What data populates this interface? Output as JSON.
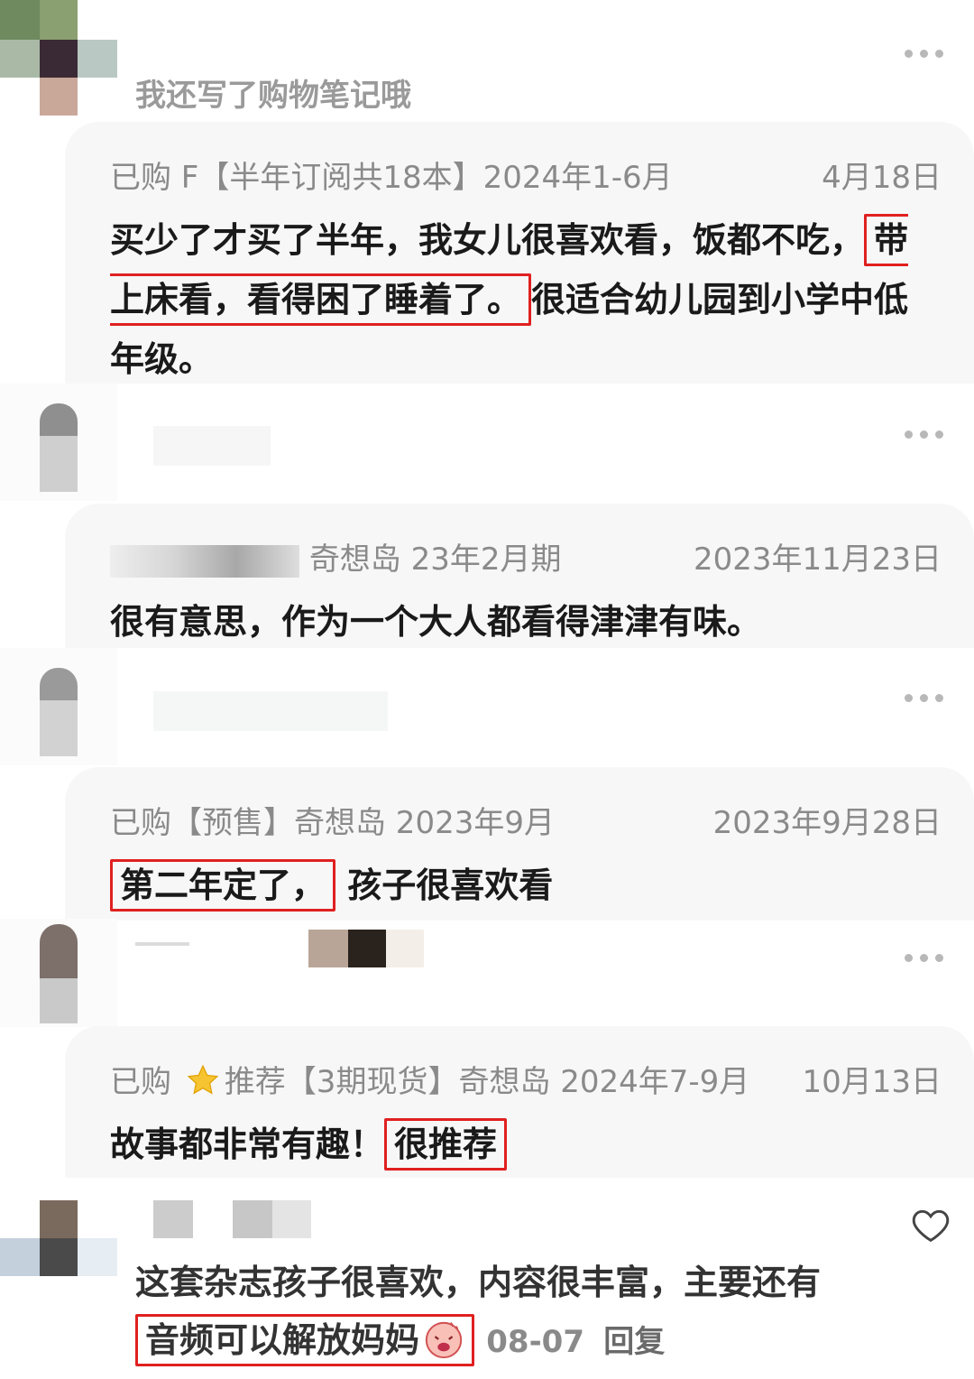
{
  "top_snippet": {
    "text": "我还写了购物笔记哦"
  },
  "reviews": [
    {
      "meta_left": "已购 F【半年订阅共18本】2024年1-6月",
      "meta_right": "4月18日",
      "text_before": "买少了才买了半年，我女儿很喜欢看，饭都不吃，",
      "text_highlight": "带上床看，看得困了睡着了。",
      "text_after": "很适合幼儿园到小学中低年级。"
    },
    {
      "meta_left": "奇想岛 23年2月期",
      "meta_right": "2023年11月23日",
      "text": "很有意思，作为一个大人都看得津津有味。"
    },
    {
      "meta_left": "已购【预售】奇想岛 2023年9月",
      "meta_right": "2023年9月28日",
      "text_highlight": "第二年定了，",
      "text_after": "孩子很喜欢看"
    },
    {
      "meta_prefix": "已购",
      "meta_badge": "推荐",
      "meta_left": "【3期现货】奇想岛 2024年7-9月",
      "meta_right": "10月13日",
      "text_before": "故事都非常有趣！",
      "text_highlight": "很推荐"
    }
  ],
  "bottom_comment": {
    "line1": "这套杂志孩子很喜欢，内容很丰富，主要还有",
    "highlight": "音频可以解放妈妈",
    "date": "08-07",
    "reply_label": "回复"
  },
  "colors": {
    "highlight_border": "#e02020",
    "meta": "#8a8a8a",
    "card_bg": "#f7f7f7"
  },
  "icons": [
    "more-dots-icon",
    "star-icon",
    "heart-icon",
    "emoji-icon"
  ]
}
